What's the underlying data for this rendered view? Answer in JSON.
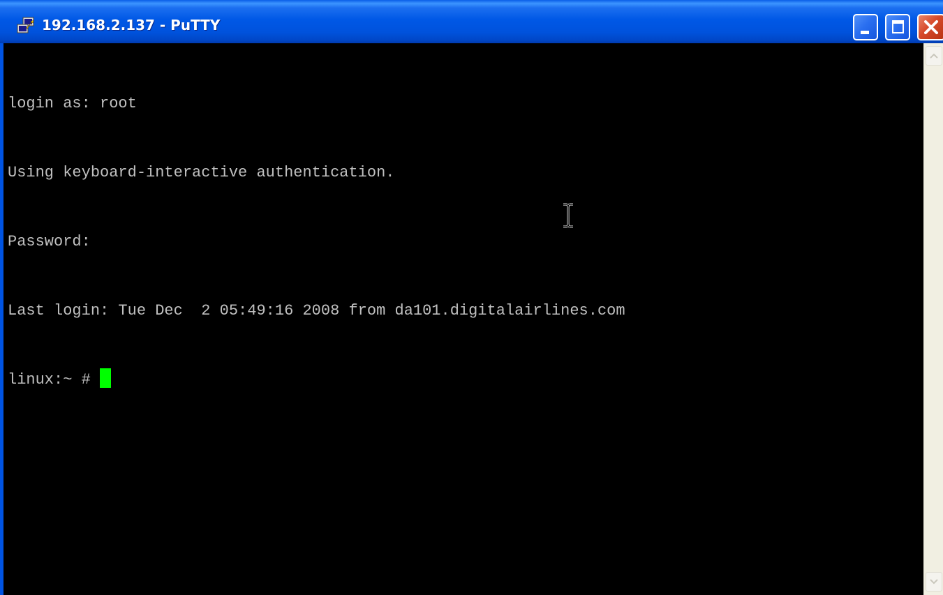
{
  "window": {
    "title": "192.168.2.137 - PuTTY"
  },
  "titlebar_buttons": {
    "minimize": "minimize-icon",
    "maximize": "maximize-icon",
    "close": "close-icon"
  },
  "terminal": {
    "lines": [
      "login as: root",
      "Using keyboard-interactive authentication.",
      "Password:",
      "Last login: Tue Dec  2 05:49:16 2008 from da101.digitalairlines.com"
    ],
    "prompt": "linux:~ # ",
    "foreground": "#c0c0c0",
    "background": "#000000",
    "cursor_color": "#00ff00"
  },
  "colors": {
    "titlebar": "#0054e3",
    "close_button": "#d6492a"
  }
}
